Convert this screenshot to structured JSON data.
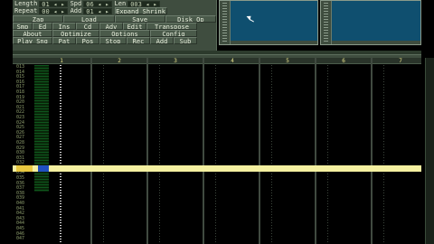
{
  "panel": {
    "length_label": "Length",
    "length_value": "01 ◂ ▸",
    "spd_label": "Spd",
    "spd_value": "06 ◂ ▸",
    "len_label": "Len",
    "len_value": "003 ◂ ▸",
    "repeat_label": "Repeat",
    "repeat_value": "00 ◂ ▸",
    "add_label": "Add",
    "add_value": "01 ◂ ▸",
    "expand_label": "Expand Shrink",
    "buttons": [
      "Zap",
      "Load",
      "Save",
      "Disk Op",
      "Smp",
      "Ed",
      "Ins",
      "Cd",
      "Adv",
      "Edit",
      "Transpose",
      "About",
      "Optimize",
      "Options",
      "Config",
      "Play Sng",
      "Pat",
      "Pos",
      "Stop",
      "Rec",
      "Add",
      "Sub"
    ]
  },
  "tracks": [
    "1",
    "2",
    "3",
    "4",
    "5",
    "6",
    "7"
  ],
  "rows": [
    "013",
    "014",
    "015",
    "016",
    "017",
    "018",
    "019",
    "020",
    "021",
    "022",
    "023",
    "024",
    "025",
    "026",
    "027",
    "028",
    "029",
    "030",
    "031",
    "032",
    "033",
    "034",
    "035",
    "036",
    "037",
    "038",
    "039",
    "040",
    "041",
    "042",
    "043",
    "044",
    "045",
    "046",
    "047"
  ]
}
